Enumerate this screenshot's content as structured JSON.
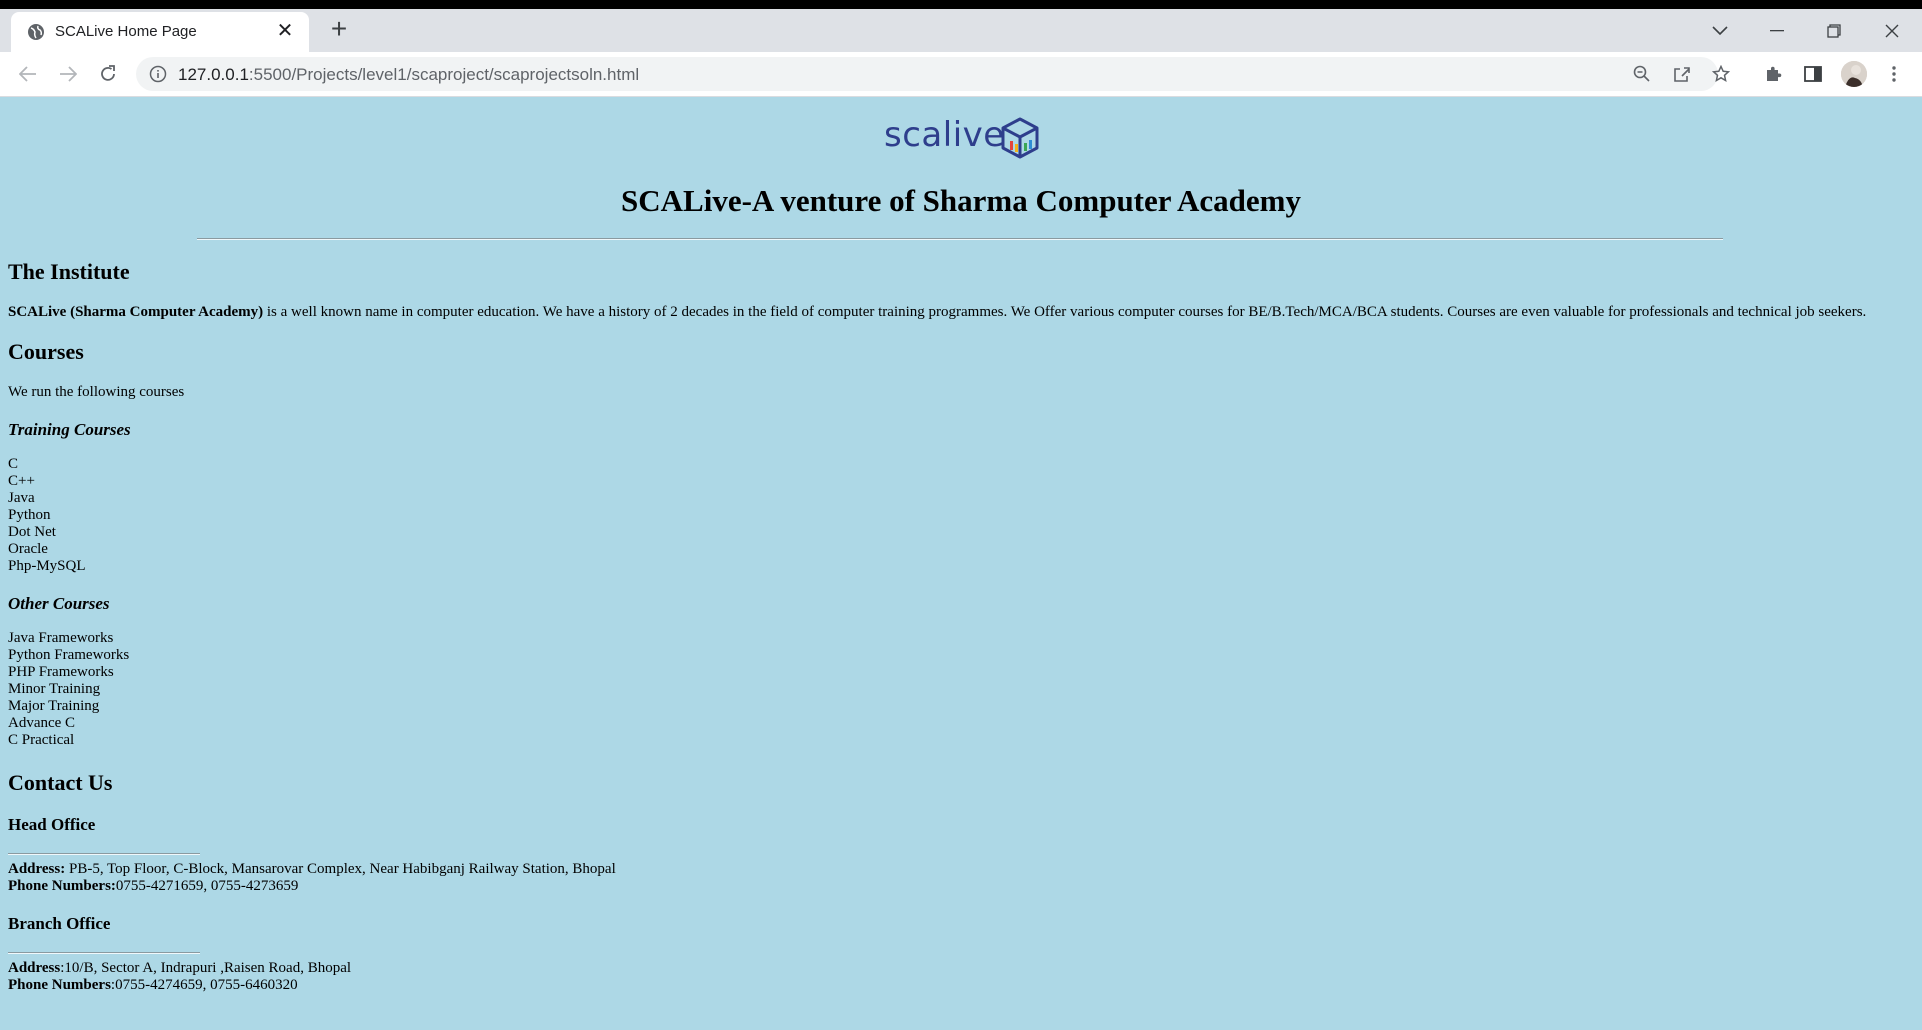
{
  "browser": {
    "tab_title": "SCALive Home Page",
    "url_host": "127.0.0.1",
    "url_rest": ":5500/Projects/level1/scaproject/scaprojectsoln.html"
  },
  "page": {
    "logo_text": "scalive",
    "title": "SCALive-A venture of Sharma Computer Academy",
    "institute": {
      "heading": "The Institute",
      "bold_name": "SCALive (Sharma Computer Academy)",
      "text": " is a well known name in computer education. We have a history of 2 decades in the field of computer training programmes. We Offer various computer courses for BE/B.Tech/MCA/BCA students. Courses are even valuable for professionals and technical job seekers."
    },
    "courses": {
      "heading": "Courses",
      "intro": "We run the following courses",
      "training_heading": "Training Courses",
      "training": [
        "C",
        "C++",
        "Java",
        "Python",
        "Dot Net",
        "Oracle",
        "Php-MySQL"
      ],
      "other_heading": "Other Courses",
      "other": [
        "Java Frameworks",
        "Python Frameworks",
        "PHP Frameworks",
        "Minor Training",
        "Major Training",
        "Advance C",
        "C Practical"
      ]
    },
    "contact": {
      "heading": "Contact Us",
      "head_office": {
        "heading": "Head Office",
        "address_label": "Address:",
        "address": " PB-5, Top Floor, C-Block, Mansarovar Complex, Near Habibganj Railway Station, Bhopal",
        "phone_label": "Phone Numbers:",
        "phone": "0755-4271659, 0755-4273659"
      },
      "branch_office": {
        "heading": "Branch Office",
        "address_label": "Address",
        "address": ":10/B, Sector A, Indrapuri ,Raisen Road, Bhopal",
        "phone_label": "Phone Numbers",
        "phone": ":0755-4274659, 0755-6460320"
      }
    }
  }
}
